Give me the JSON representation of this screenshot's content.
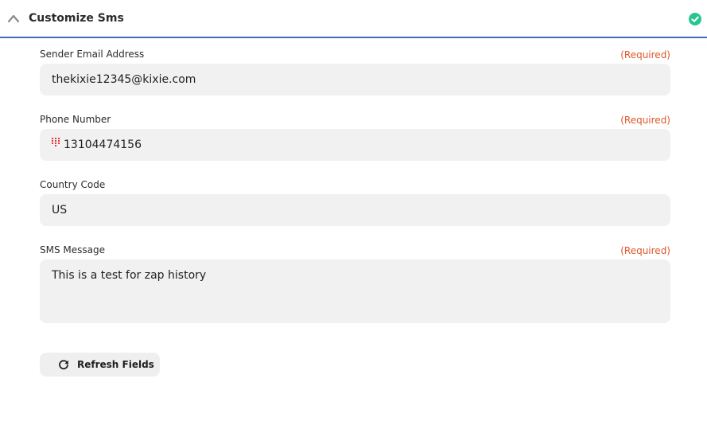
{
  "section": {
    "title": "Customize Sms",
    "status_color": "#2ac58f",
    "accent_color": "#3d6fb6"
  },
  "fields": [
    {
      "label": "Sender Email Address",
      "required_text": "(Required)",
      "value": "thekixie12345@kixie.com"
    },
    {
      "label": "Phone Number",
      "required_text": "(Required)",
      "value": "13104474156",
      "icon": "keypad-icon"
    },
    {
      "label": "Country Code",
      "value": "US"
    },
    {
      "label": "SMS Message",
      "required_text": "(Required)",
      "value": "This is a test for zap history"
    }
  ],
  "actions": {
    "refresh_label": "Refresh Fields",
    "refresh_icon": "refresh-icon"
  }
}
